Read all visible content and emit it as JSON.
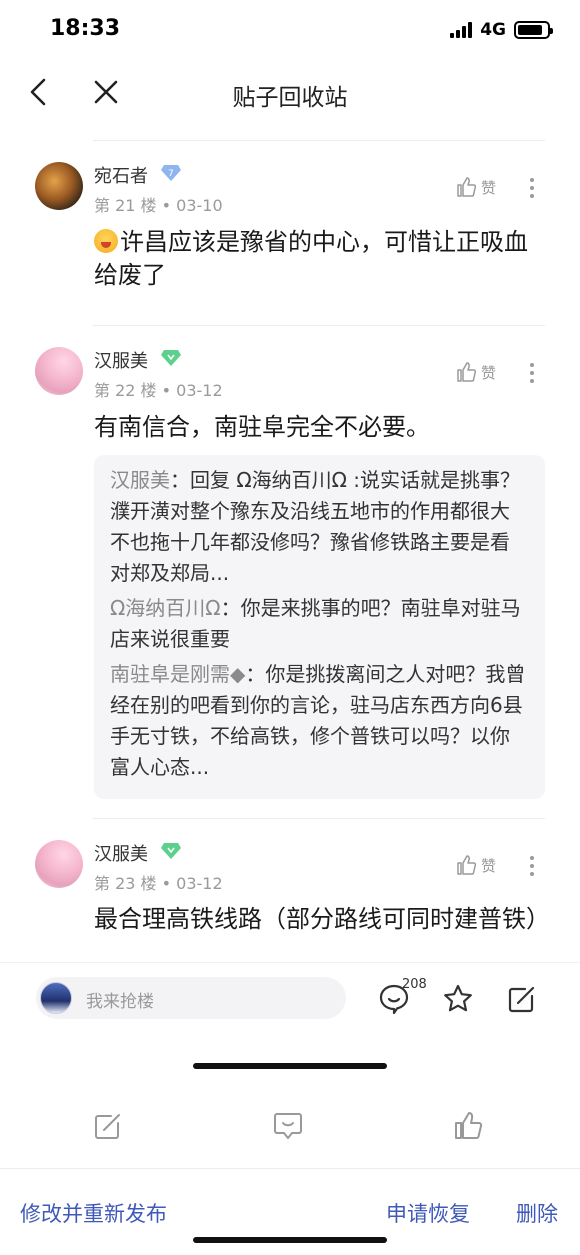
{
  "status_bar": {
    "time": "18:33",
    "network": "4G"
  },
  "nav": {
    "title": "贴子回收站"
  },
  "posts": [
    {
      "username": "宛石者",
      "level": "7",
      "floor_date": "第 21 楼 • 03-10",
      "like_label": "赞",
      "content": "许昌应该是豫省的中心，可惜让正吸血给废了"
    },
    {
      "username": "汉服美",
      "floor_date": "第 22 楼 • 03-12",
      "like_label": "赞",
      "content": "有南信合，南驻阜完全不必要。",
      "replies": [
        {
          "name": "汉服美",
          "text": "：回复 Ω海纳百川Ω :说实话就是挑事？濮开潢对整个豫东及沿线五地市的作用都很大不也拖十几年都没修吗？豫省修铁路主要是看对郑及郑局..."
        },
        {
          "name": "Ω海纳百川Ω",
          "text": "：你是来挑事的吧？南驻阜对驻马店来说很重要"
        },
        {
          "name": "南驻阜是刚需◆",
          "text": "：你是挑拨离间之人对吧？我曾经在别的吧看到你的言论，驻马店东西方向6县手无寸铁，不给高铁，修个普铁可以吗？以你富人心态..."
        }
      ]
    },
    {
      "username": "汉服美",
      "floor_date": "第 23 楼 • 03-12",
      "like_label": "赞",
      "content": "最合理高铁线路（部分路线可同时建普铁）"
    }
  ],
  "comment_bar": {
    "placeholder": "我来抢楼",
    "comment_count": "208"
  },
  "actions": {
    "edit_republish": "修改并重新发布",
    "restore": "申请恢复",
    "delete": "删除"
  },
  "colors": {
    "link": "#3f59b8",
    "meta": "#9a9a9a"
  }
}
